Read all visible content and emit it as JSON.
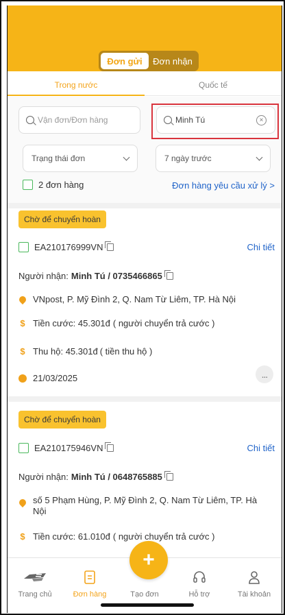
{
  "header": {
    "segments": [
      {
        "label": "Đơn gửi",
        "active": true
      },
      {
        "label": "Đơn nhận",
        "active": false
      }
    ],
    "brand_color": "#f6b417"
  },
  "tabs": [
    {
      "label": "Trong nước",
      "active": true
    },
    {
      "label": "Quốc tế",
      "active": false
    }
  ],
  "filters": {
    "waybill_search": {
      "value": "",
      "placeholder": "Vận đơn/Đơn hàng"
    },
    "name_search": {
      "value": "Minh Tú"
    },
    "status_select": {
      "value": "Trạng thái đơn"
    },
    "date_select": {
      "value": "7 ngày trước"
    },
    "order_count": "2 đơn hàng",
    "requested_orders_link": "Đơn hàng yêu cầu xử lý >"
  },
  "orders": [
    {
      "status": "Chờ để chuyển hoàn",
      "code": "EA210176999VN",
      "detail_label": "Chi tiết",
      "recipient_label": "Người nhận:",
      "recipient": "Minh Tú / 0735466865",
      "address": "VNpost, P. Mỹ Đình 2, Q. Nam Từ Liêm, TP. Hà Nội",
      "fee": "Tiền cước: 45.301đ",
      "fee_note": "( người chuyển trả cước )",
      "cod": "Thu hộ: 45.301đ",
      "cod_note": "( tiền thu hộ )",
      "date": "21/03/2025",
      "more": "..."
    },
    {
      "status": "Chờ để chuyển hoàn",
      "code": "EA210175946VN",
      "detail_label": "Chi tiết",
      "recipient_label": "Người nhận:",
      "recipient": "Minh Tú / 0648765885",
      "address_line1": "số 5 Phạm Hùng, P. Mỹ Đình 2, Q. Nam Từ Liêm, TP. Hà",
      "address_line2": "Nội",
      "fee": "Tiền cước: 61.010đ",
      "fee_note": "( người chuyển trả cước )"
    }
  ],
  "nav": [
    {
      "label": "Trang chủ",
      "icon": "truck-icon",
      "active": false
    },
    {
      "label": "Đơn hàng",
      "icon": "document-icon",
      "active": true
    },
    {
      "label": "Tạo đơn",
      "icon": "plus-icon",
      "active": false
    },
    {
      "label": "Hỗ trợ",
      "icon": "headset-icon",
      "active": false
    },
    {
      "label": "Tài khoản",
      "icon": "user-icon",
      "active": false
    }
  ],
  "fab_symbol": "+"
}
